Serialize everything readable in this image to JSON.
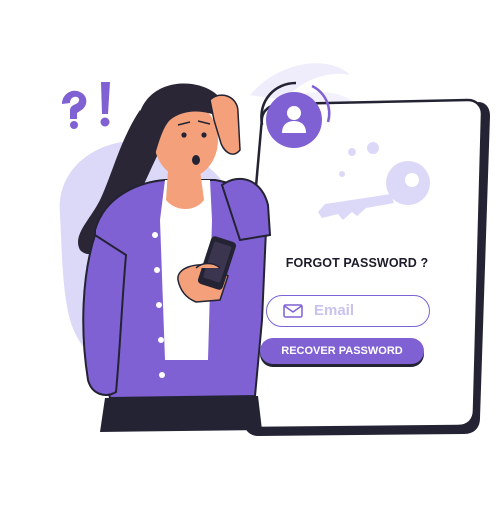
{
  "form": {
    "heading": "FORGOT PASSWORD ?",
    "email_placeholder": "Email",
    "recover_label": "RECOVER PASSWORD"
  },
  "icons": {
    "avatar": "user-avatar-icon",
    "key": "key-icon",
    "mail": "envelope-icon",
    "confusion": "question-exclamation-icon",
    "phone": "smartphone-icon"
  },
  "colors": {
    "accent": "#7f61d3",
    "light_lavender": "#d9d5f7",
    "outline": "#232334",
    "skin": "#f4a07a",
    "hair": "#2b2635"
  }
}
